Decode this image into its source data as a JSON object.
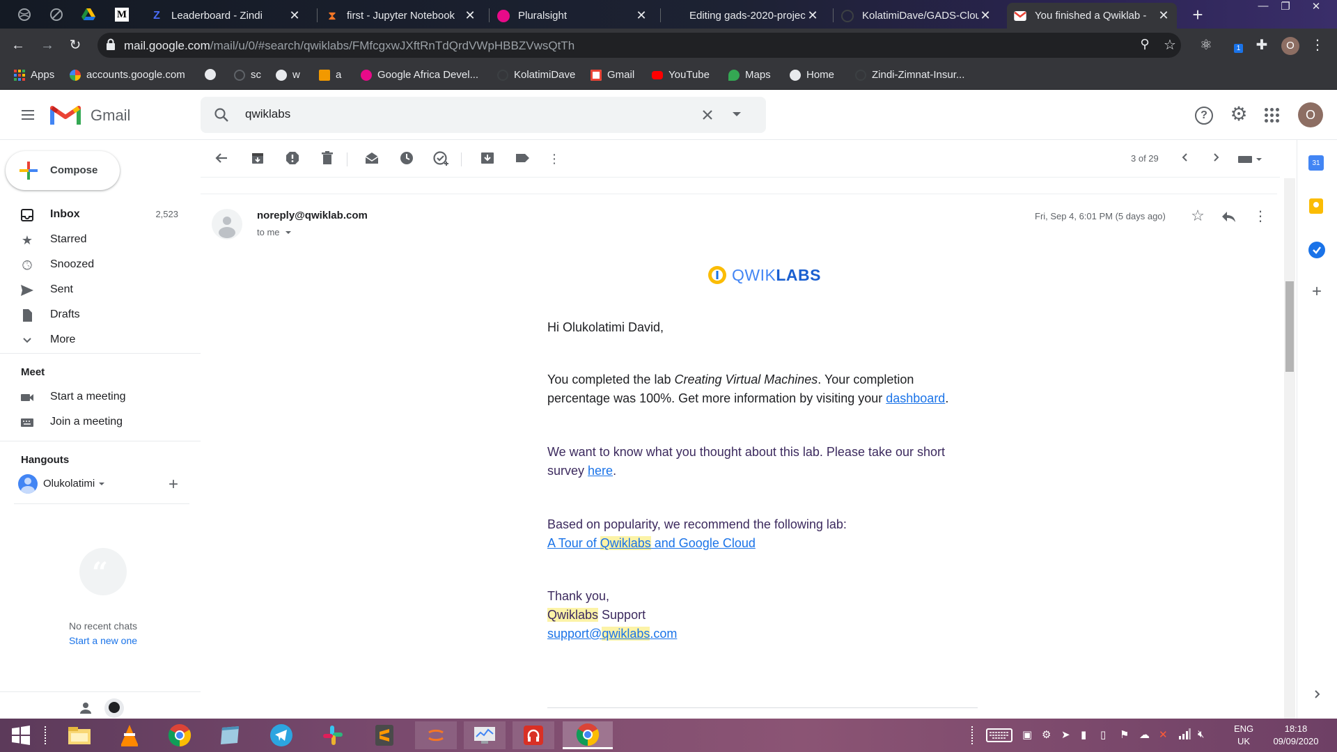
{
  "browser": {
    "tabs": [
      {
        "title": "Leaderboard - Zindi",
        "active": false
      },
      {
        "title": "first - Jupyter Notebook",
        "active": false
      },
      {
        "title": "Pluralsight",
        "active": false
      },
      {
        "title": "Editing gads-2020-projec",
        "active": false
      },
      {
        "title": "KolatimiDave/GADS-Clou",
        "active": false
      },
      {
        "title": "You finished a Qwiklab -",
        "active": true
      }
    ],
    "url_domain": "mail.google.com",
    "url_path": "/mail/u/0/#search/qwiklabs/FMfcgxwJXftRnTdQrdVWpHBBZVwsQtTh",
    "profile_initial": "O",
    "extension_badge": "1",
    "bookmarks": [
      "Apps",
      "accounts.google.com",
      "sc",
      "w",
      "a",
      "Google Africa Devel...",
      "KolatimiDave",
      "Gmail",
      "YouTube",
      "Maps",
      "Home",
      "Zindi-Zimnat-Insur..."
    ]
  },
  "gmail": {
    "logo_text": "Gmail",
    "search_value": "qwiklabs",
    "avatar_initial": "O",
    "compose_label": "Compose",
    "nav": [
      {
        "label": "Inbox",
        "count": "2,523",
        "icon": "inbox-icon"
      },
      {
        "label": "Starred",
        "count": "",
        "icon": "star-icon"
      },
      {
        "label": "Snoozed",
        "count": "",
        "icon": "clock-icon"
      },
      {
        "label": "Sent",
        "count": "",
        "icon": "send-icon"
      },
      {
        "label": "Drafts",
        "count": "",
        "icon": "draft-icon"
      },
      {
        "label": "More",
        "count": "",
        "icon": "chevron-down-icon"
      }
    ],
    "meet": {
      "heading": "Meet",
      "items": [
        "Start a meeting",
        "Join a meeting"
      ]
    },
    "hangouts": {
      "heading": "Hangouts",
      "user": "Olukolatimi",
      "no_chats": "No recent chats",
      "start_new": "Start a new one"
    },
    "pagination": "3 of 29",
    "message": {
      "sender": "noreply@qwiklab.com",
      "to": "to me",
      "date": "Fri, Sep 4, 6:01 PM (5 days ago)",
      "logo_text": "QWIKLABS",
      "logo_text_light": "QWIK",
      "logo_text_bold": "LABS",
      "greeting": "Hi Olukolatimi David,",
      "p1_a": "You completed the lab ",
      "p1_lab": "Creating Virtual Machines",
      "p1_b": ". Your completion percentage was 100%. Get more information by visiting your ",
      "p1_link": "dashboard",
      "p1_end": ".",
      "p2_a": "We want to know what you thought about this lab. Please take our short survey ",
      "p2_link": "here",
      "p2_end": ".",
      "p3": "Based on popularity, we recommend the following lab:",
      "p3_link_a": "A Tour of ",
      "p3_link_hl": "Qwiklabs",
      "p3_link_b": " and Google Cloud",
      "thanks": "Thank you,",
      "sign_hl": "Qwiklabs",
      "sign_b": " Support",
      "email_a": "support@",
      "email_hl": "qwiklabs",
      "email_b": ".com"
    }
  },
  "taskbar": {
    "lang_top": "ENG",
    "lang_bottom": "UK",
    "time": "18:18",
    "date": "09/09/2020"
  },
  "colors": {
    "gmail_red": "#ea4335",
    "link_blue": "#1a73e8",
    "email_text": "#3c2a5e",
    "highlight": "#fcf3a7",
    "chrome_dark": "#35363a"
  }
}
